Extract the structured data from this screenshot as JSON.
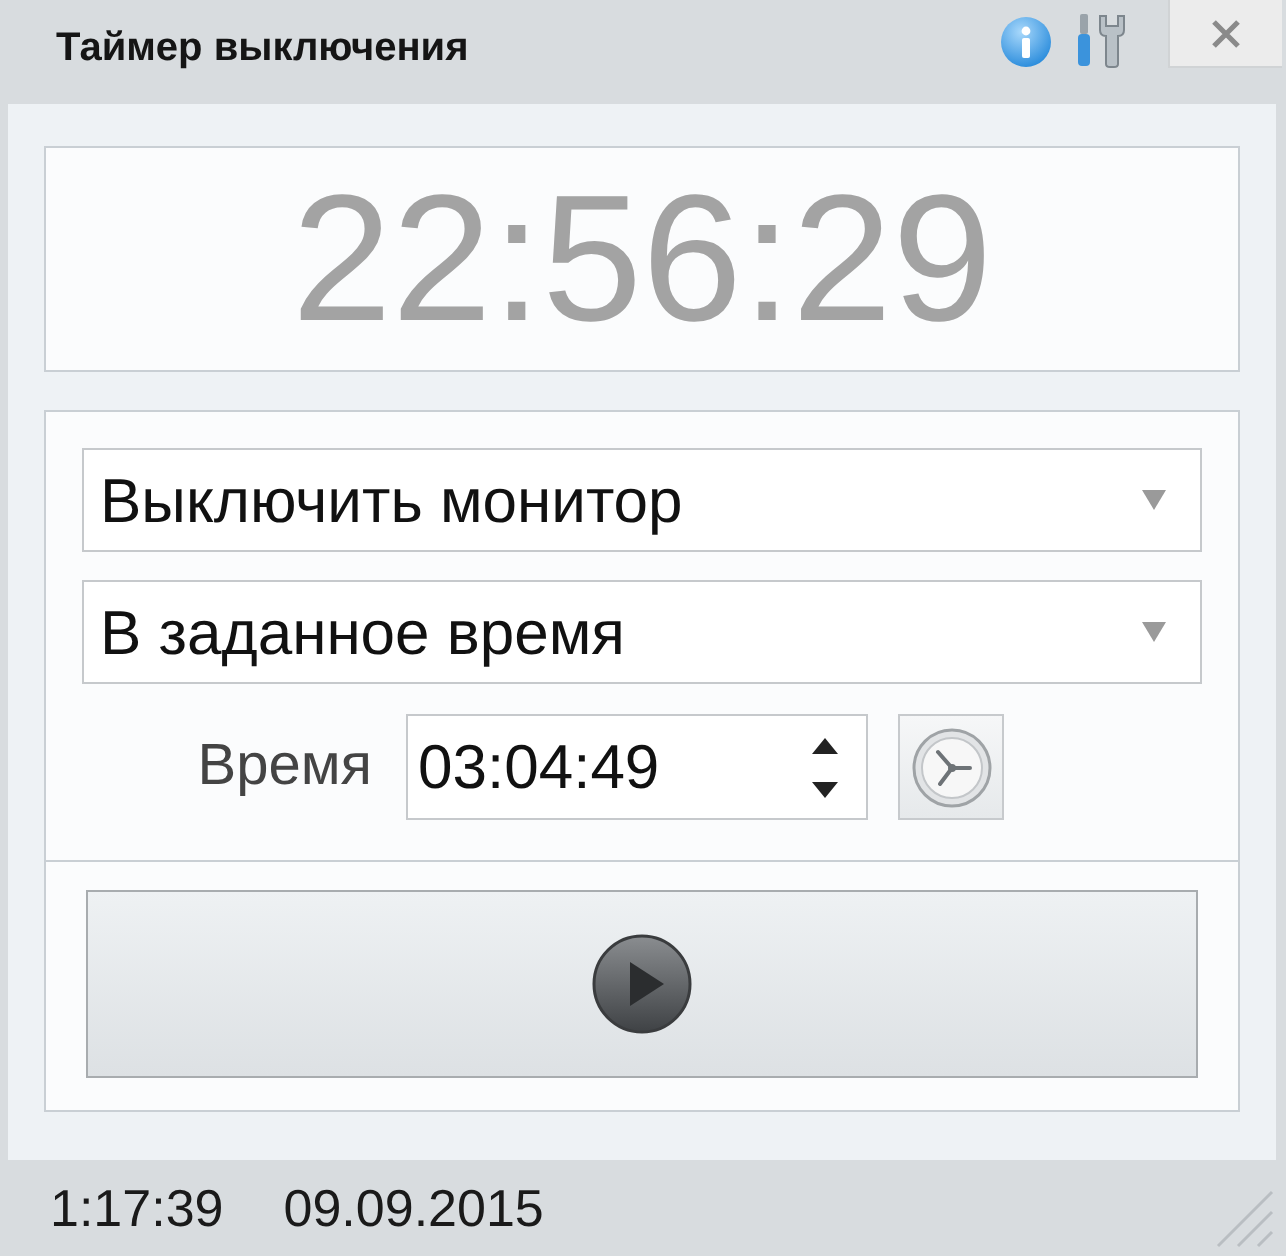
{
  "window": {
    "title": "Таймер выключения"
  },
  "clock": {
    "time": "22:56:29"
  },
  "selects": [
    {
      "value": "Выключить монитор"
    },
    {
      "value": "В заданное время"
    }
  ],
  "time_field": {
    "label": "Время",
    "value": "03:04:49"
  },
  "status_bar": {
    "time": "1:17:39",
    "date": "09.09.2015"
  }
}
